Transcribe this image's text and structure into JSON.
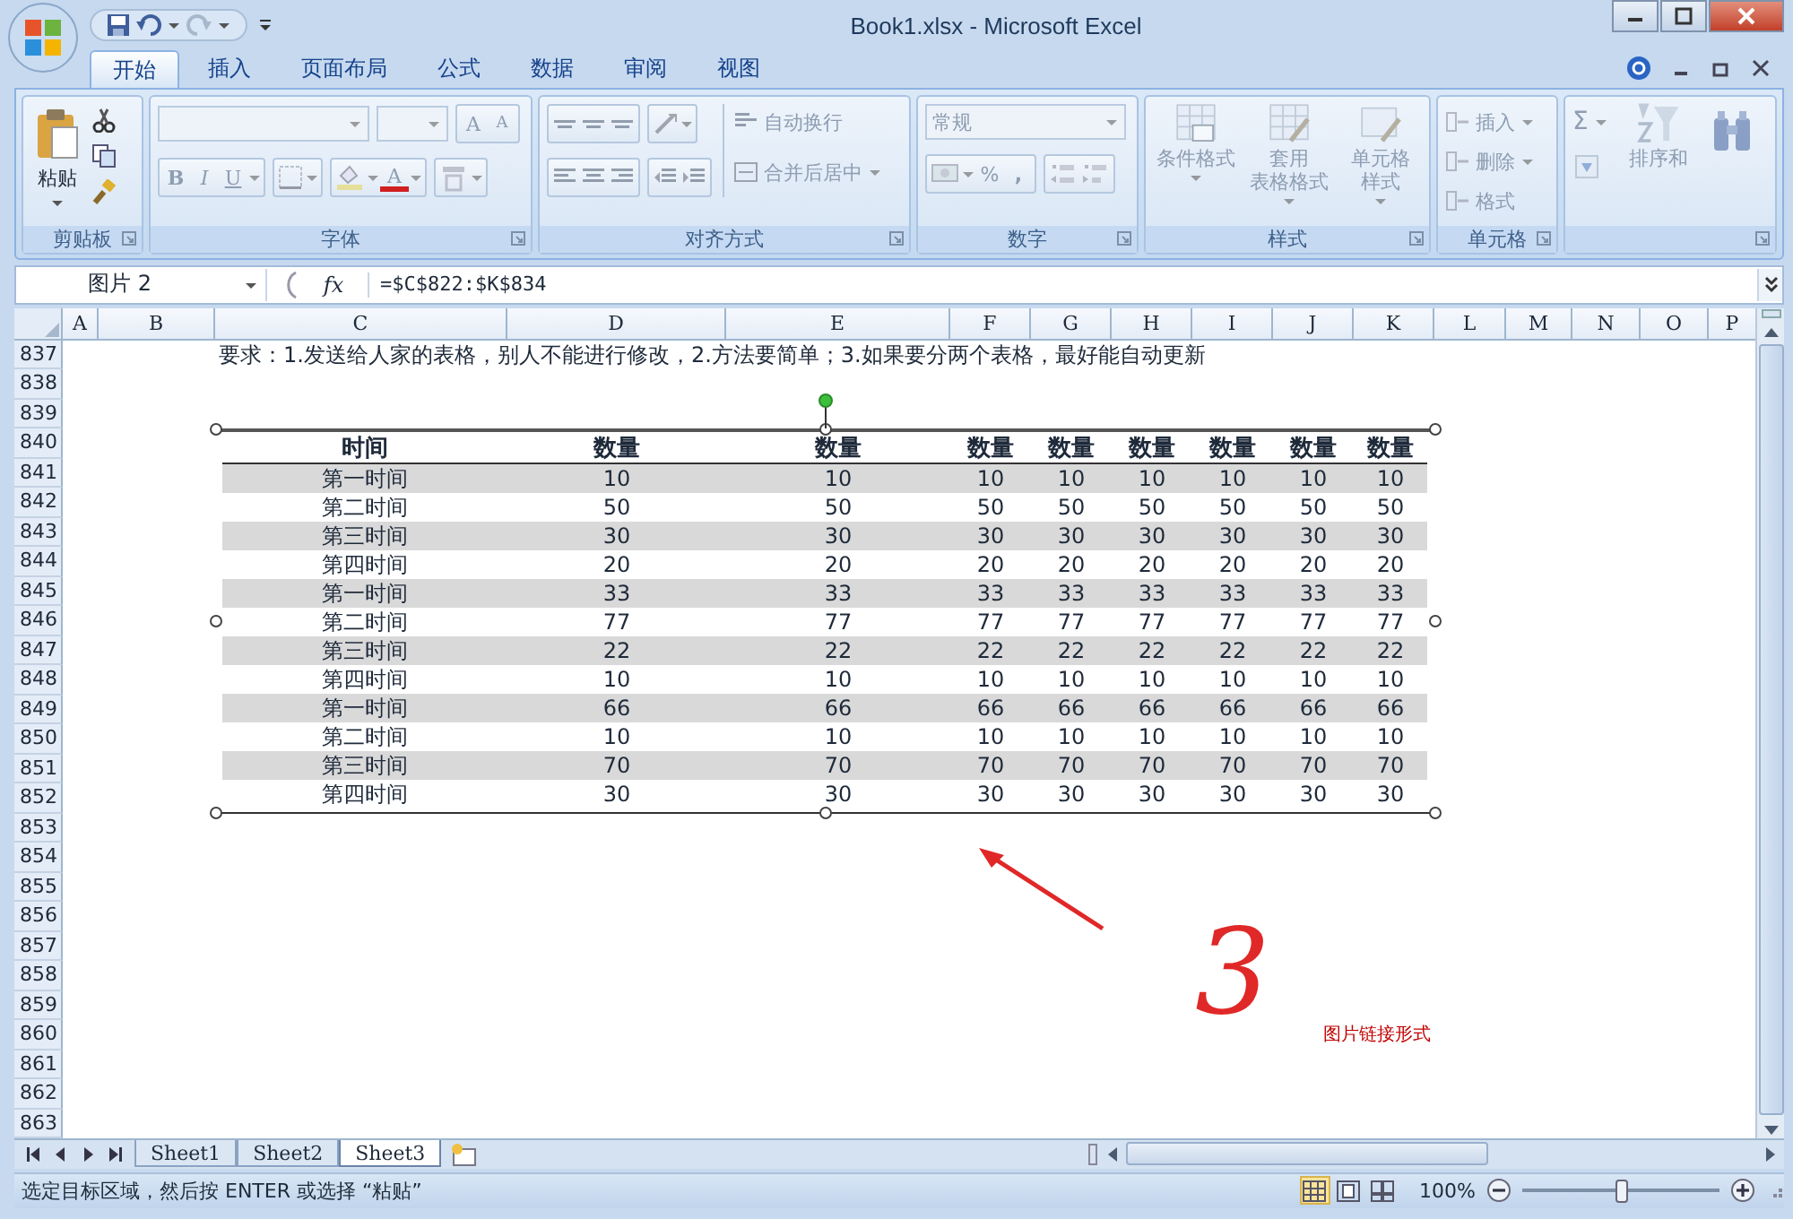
{
  "window": {
    "title": "Book1.xlsx - Microsoft Excel"
  },
  "tabs": [
    {
      "label": "开始",
      "selected": true
    },
    {
      "label": "插入",
      "selected": false
    },
    {
      "label": "页面布局",
      "selected": false
    },
    {
      "label": "公式",
      "selected": false
    },
    {
      "label": "数据",
      "selected": false
    },
    {
      "label": "审阅",
      "selected": false
    },
    {
      "label": "视图",
      "selected": false
    }
  ],
  "ribbon": {
    "clipboard": {
      "label": "剪贴板",
      "paste": "粘贴",
      "disabled": false
    },
    "font": {
      "label": "字体",
      "grow": "A",
      "shrink": "A",
      "bold": "B",
      "italic": "I",
      "underline": "U",
      "font_color": "A",
      "disabled": true
    },
    "alignment": {
      "label": "对齐方式",
      "wrap_text": "自动换行",
      "merge_center": "合并后居中",
      "disabled": true
    },
    "number": {
      "label": "数字",
      "format": "常规",
      "percent": "%",
      "comma": ",",
      "disabled": true
    },
    "styles": {
      "label": "样式",
      "conditional": [
        "条件格式"
      ],
      "table": [
        "套用",
        "表格格式"
      ],
      "cell_styles": [
        "单元格",
        "样式"
      ],
      "disabled": true
    },
    "cells": {
      "label": "单元格",
      "insert": "插入",
      "delete": "删除",
      "format": "格式",
      "disabled": true
    },
    "editing": {
      "sum": "Σ",
      "sort": "排序和",
      "disabled": true
    }
  },
  "formula_bar": {
    "name_box": "图片 2",
    "fx": "fx",
    "formula": "=$C$822:$K$834"
  },
  "sheet": {
    "columns": [
      "A",
      "B",
      "C",
      "D",
      "E",
      "F",
      "G",
      "H",
      "I",
      "J",
      "K",
      "L",
      "M",
      "N",
      "O",
      "P"
    ],
    "rows": [
      {
        "number": "837",
        "text": "要求：1.发送给人家的表格，别人不能进行修改，2.方法要简单；3.如果要分两个表格，最好能自动更新",
        "kind": "note"
      },
      {
        "number": "838"
      },
      {
        "number": "839"
      },
      {
        "number": "840"
      },
      {
        "number": "841"
      },
      {
        "number": "842"
      },
      {
        "number": "843"
      },
      {
        "number": "844"
      },
      {
        "number": "845"
      },
      {
        "number": "846"
      },
      {
        "number": "847"
      },
      {
        "number": "848"
      },
      {
        "number": "849"
      },
      {
        "number": "850"
      },
      {
        "number": "851"
      },
      {
        "number": "852"
      },
      {
        "number": "853"
      },
      {
        "number": "854"
      },
      {
        "number": "855"
      },
      {
        "number": "856"
      },
      {
        "number": "857"
      },
      {
        "number": "858"
      },
      {
        "number": "859"
      },
      {
        "number": "860",
        "text": "图片链接形式",
        "kind": "caption"
      },
      {
        "number": "861"
      },
      {
        "number": "862"
      },
      {
        "number": "863"
      }
    ]
  },
  "picture": {
    "headers": [
      "时间",
      "数量",
      "数量",
      "数量",
      "数量",
      "数量",
      "数量",
      "数量",
      "数量"
    ],
    "rows": [
      {
        "time": "第一时间",
        "values": [
          "10",
          "10",
          "10",
          "10",
          "10",
          "10",
          "10",
          "10"
        ],
        "shaded": true
      },
      {
        "time": "第二时间",
        "values": [
          "50",
          "50",
          "50",
          "50",
          "50",
          "50",
          "50",
          "50"
        ],
        "shaded": false
      },
      {
        "time": "第三时间",
        "values": [
          "30",
          "30",
          "30",
          "30",
          "30",
          "30",
          "30",
          "30"
        ],
        "shaded": true
      },
      {
        "time": "第四时间",
        "values": [
          "20",
          "20",
          "20",
          "20",
          "20",
          "20",
          "20",
          "20"
        ],
        "shaded": false
      },
      {
        "time": "第一时间",
        "values": [
          "33",
          "33",
          "33",
          "33",
          "33",
          "33",
          "33",
          "33"
        ],
        "shaded": true
      },
      {
        "time": "第二时间",
        "values": [
          "77",
          "77",
          "77",
          "77",
          "77",
          "77",
          "77",
          "77"
        ],
        "shaded": false
      },
      {
        "time": "第三时间",
        "values": [
          "22",
          "22",
          "22",
          "22",
          "22",
          "22",
          "22",
          "22"
        ],
        "shaded": true
      },
      {
        "time": "第四时间",
        "values": [
          "10",
          "10",
          "10",
          "10",
          "10",
          "10",
          "10",
          "10"
        ],
        "shaded": false
      },
      {
        "time": "第一时间",
        "values": [
          "66",
          "66",
          "66",
          "66",
          "66",
          "66",
          "66",
          "66"
        ],
        "shaded": true
      },
      {
        "time": "第二时间",
        "values": [
          "10",
          "10",
          "10",
          "10",
          "10",
          "10",
          "10",
          "10"
        ],
        "shaded": false
      },
      {
        "time": "第三时间",
        "values": [
          "70",
          "70",
          "70",
          "70",
          "70",
          "70",
          "70",
          "70"
        ],
        "shaded": true
      },
      {
        "time": "第四时间",
        "values": [
          "30",
          "30",
          "30",
          "30",
          "30",
          "30",
          "30",
          "30"
        ],
        "shaded": false
      }
    ]
  },
  "annotation": {
    "number": "3"
  },
  "sheet_tabs": [
    {
      "label": "Sheet1",
      "selected": false
    },
    {
      "label": "Sheet2",
      "selected": false
    },
    {
      "label": "Sheet3",
      "selected": true
    }
  ],
  "status_bar": {
    "text": "选定目标区域，然后按 ENTER 或选择 “粘贴”",
    "views": [
      {
        "selected": true
      },
      {
        "selected": false
      },
      {
        "selected": false
      }
    ],
    "zoom": "100%",
    "level": 0.5
  }
}
